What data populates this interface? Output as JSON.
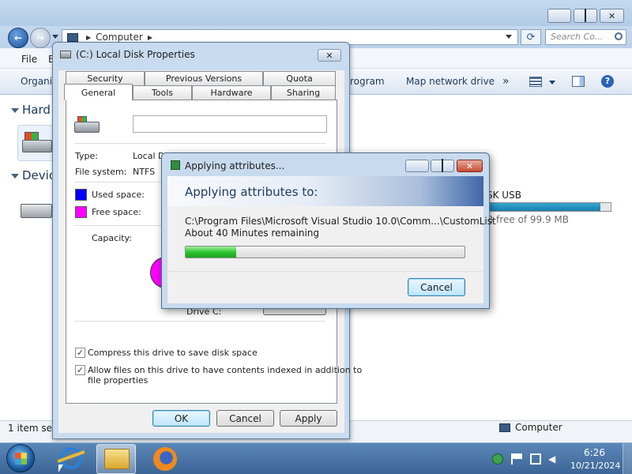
{
  "explorer": {
    "breadcrumb": "Computer",
    "search_placeholder": "Search Co...",
    "menu": [
      "File",
      "E"
    ],
    "toolbar": {
      "organize": "Organiz",
      "program": "rogram",
      "map_network_drive": "Map network drive",
      "more": "»"
    },
    "nav": {
      "hard": "Hard",
      "devices": "Devic"
    },
    "usb": {
      "label": "SK USB",
      "free_text": "B free of 99.9 MB",
      "used_fraction": 0.92
    },
    "status": {
      "count": "1 item sele",
      "location": "Computer"
    }
  },
  "properties": {
    "title": "(C:) Local Disk Properties",
    "tabs_back": [
      "Security",
      "Previous Versions",
      "Quota"
    ],
    "tabs_front": [
      "General",
      "Tools",
      "Hardware",
      "Sharing"
    ],
    "type_label": "Type:",
    "type_value": "Local D",
    "fs_label": "File system:",
    "fs_value": "NTFS",
    "used_label": "Used space:",
    "free_label": "Free space:",
    "capacity_label": "Capacity:",
    "drive_label": "Drive C:",
    "compress_label": "Compress this drive to save disk space",
    "index_label_1": "Allow files on this drive to have contents indexed in addition to",
    "index_label_2": "file properties",
    "ok": "OK",
    "cancel": "Cancel",
    "apply": "Apply",
    "colors": {
      "used": "#0000ff",
      "free": "#ff00ff"
    }
  },
  "apply_dialog": {
    "title": "Applying attributes...",
    "heading": "Applying attributes to:",
    "path": "C:\\Program Files\\Microsoft Visual Studio 10.0\\Comm...\\CustomList",
    "remaining": "About 40 Minutes remaining",
    "progress": 0.18,
    "cancel": "Cancel"
  },
  "taskbar": {
    "time": "6:26",
    "date": "10/21/2024"
  }
}
